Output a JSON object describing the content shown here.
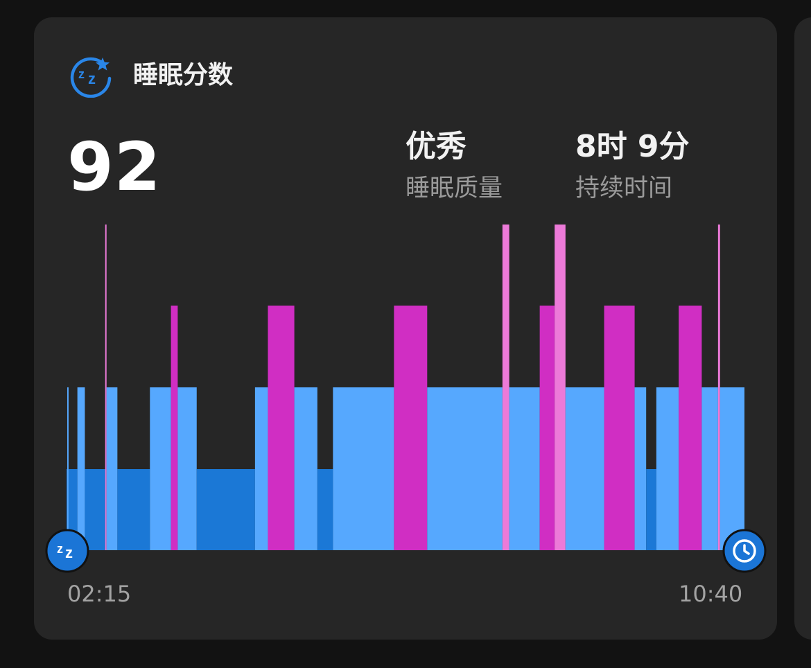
{
  "header": {
    "title": "睡眠分数",
    "icon": "sleep-zz-star-icon"
  },
  "summary": {
    "score": "92",
    "quality_value": "优秀",
    "quality_label": "睡眠质量",
    "duration_value": "8时 9分",
    "duration_label": "持续时间"
  },
  "timeline": {
    "start_time": "02:15",
    "end_time": "10:40",
    "start_icon": "sleep-zz-icon",
    "end_icon": "alarm-clock-icon"
  },
  "colors": {
    "background": "#121212",
    "card": "#262626",
    "deep": "#1b78d6",
    "light": "#56a8fe",
    "rem": "#d02ec3",
    "awake": "#ec7ad8",
    "accent": "#2a7fdc"
  },
  "chart_data": {
    "type": "bar",
    "stage_order": [
      "deep",
      "light",
      "rem",
      "awake"
    ],
    "x_range": [
      "02:15",
      "10:40"
    ],
    "segments": [
      {
        "stage": "deep",
        "start": 0.0,
        "end": 0.001
      },
      {
        "stage": "light",
        "start": 0.001,
        "end": 0.003
      },
      {
        "stage": "deep",
        "start": 0.003,
        "end": 0.016
      },
      {
        "stage": "light",
        "start": 0.016,
        "end": 0.027
      },
      {
        "stage": "deep",
        "start": 0.027,
        "end": 0.057
      },
      {
        "stage": "awake",
        "start": 0.057,
        "end": 0.059
      },
      {
        "stage": "light",
        "start": 0.059,
        "end": 0.075
      },
      {
        "stage": "deep",
        "start": 0.075,
        "end": 0.123
      },
      {
        "stage": "light",
        "start": 0.123,
        "end": 0.154
      },
      {
        "stage": "rem",
        "start": 0.154,
        "end": 0.164
      },
      {
        "stage": "light",
        "start": 0.164,
        "end": 0.192
      },
      {
        "stage": "deep",
        "start": 0.192,
        "end": 0.278
      },
      {
        "stage": "light",
        "start": 0.278,
        "end": 0.297
      },
      {
        "stage": "rem",
        "start": 0.297,
        "end": 0.336
      },
      {
        "stage": "light",
        "start": 0.336,
        "end": 0.37
      },
      {
        "stage": "deep",
        "start": 0.37,
        "end": 0.393
      },
      {
        "stage": "light",
        "start": 0.393,
        "end": 0.483
      },
      {
        "stage": "rem",
        "start": 0.483,
        "end": 0.532
      },
      {
        "stage": "light",
        "start": 0.532,
        "end": 0.643
      },
      {
        "stage": "awake",
        "start": 0.643,
        "end": 0.653
      },
      {
        "stage": "light",
        "start": 0.653,
        "end": 0.698
      },
      {
        "stage": "rem",
        "start": 0.698,
        "end": 0.72
      },
      {
        "stage": "awake",
        "start": 0.72,
        "end": 0.736
      },
      {
        "stage": "light",
        "start": 0.736,
        "end": 0.793
      },
      {
        "stage": "rem",
        "start": 0.793,
        "end": 0.838
      },
      {
        "stage": "light",
        "start": 0.838,
        "end": 0.855
      },
      {
        "stage": "deep",
        "start": 0.855,
        "end": 0.87
      },
      {
        "stage": "light",
        "start": 0.87,
        "end": 0.903
      },
      {
        "stage": "rem",
        "start": 0.903,
        "end": 0.937
      },
      {
        "stage": "light",
        "start": 0.937,
        "end": 0.961
      },
      {
        "stage": "awake",
        "start": 0.961,
        "end": 0.964
      },
      {
        "stage": "light",
        "start": 0.964,
        "end": 1.0
      }
    ]
  }
}
